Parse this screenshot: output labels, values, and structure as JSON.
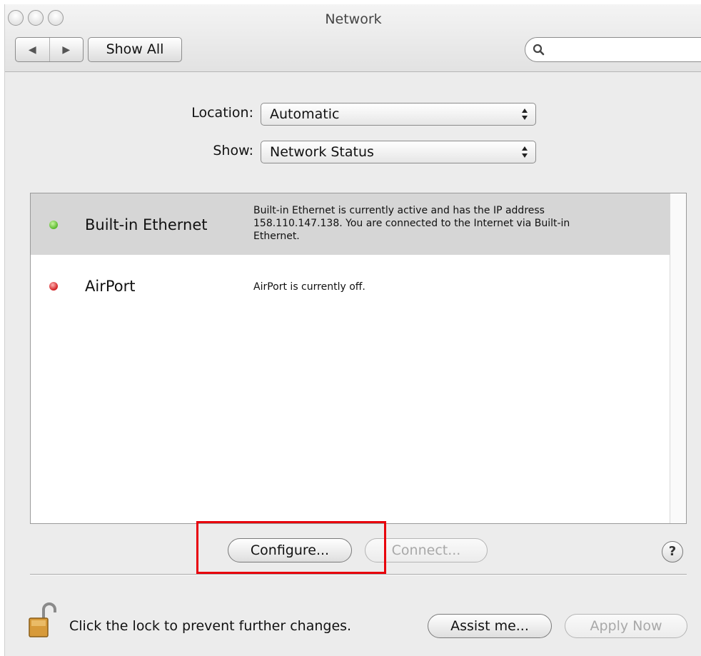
{
  "window": {
    "title": "Network",
    "back_arrow": "◀",
    "forward_arrow": "▶",
    "show_all_label": "Show All",
    "search_placeholder": ""
  },
  "settings": {
    "location_label": "Location:",
    "location_value": "Automatic",
    "show_label": "Show:",
    "show_value": "Network Status"
  },
  "services": [
    {
      "name": "Built-in Ethernet",
      "status_color": "#6cc93b",
      "selected": true,
      "desc_lines": [
        "Built-in Ethernet is currently active and has the IP address",
        "158.110.147.138. You are connected to the Internet via Built-in",
        "Ethernet."
      ]
    },
    {
      "name": "AirPort",
      "status_color": "#e0282a",
      "selected": false,
      "desc_lines": [
        "AirPort is currently off."
      ]
    }
  ],
  "buttons": {
    "configure": "Configure...",
    "connect": "Connect...",
    "help": "?",
    "assist": "Assist me...",
    "apply": "Apply Now"
  },
  "lock_message": "Click the lock to prevent further changes.",
  "colors": {
    "highlight": "#e8000c",
    "selected_row": "#d6d6d6"
  }
}
